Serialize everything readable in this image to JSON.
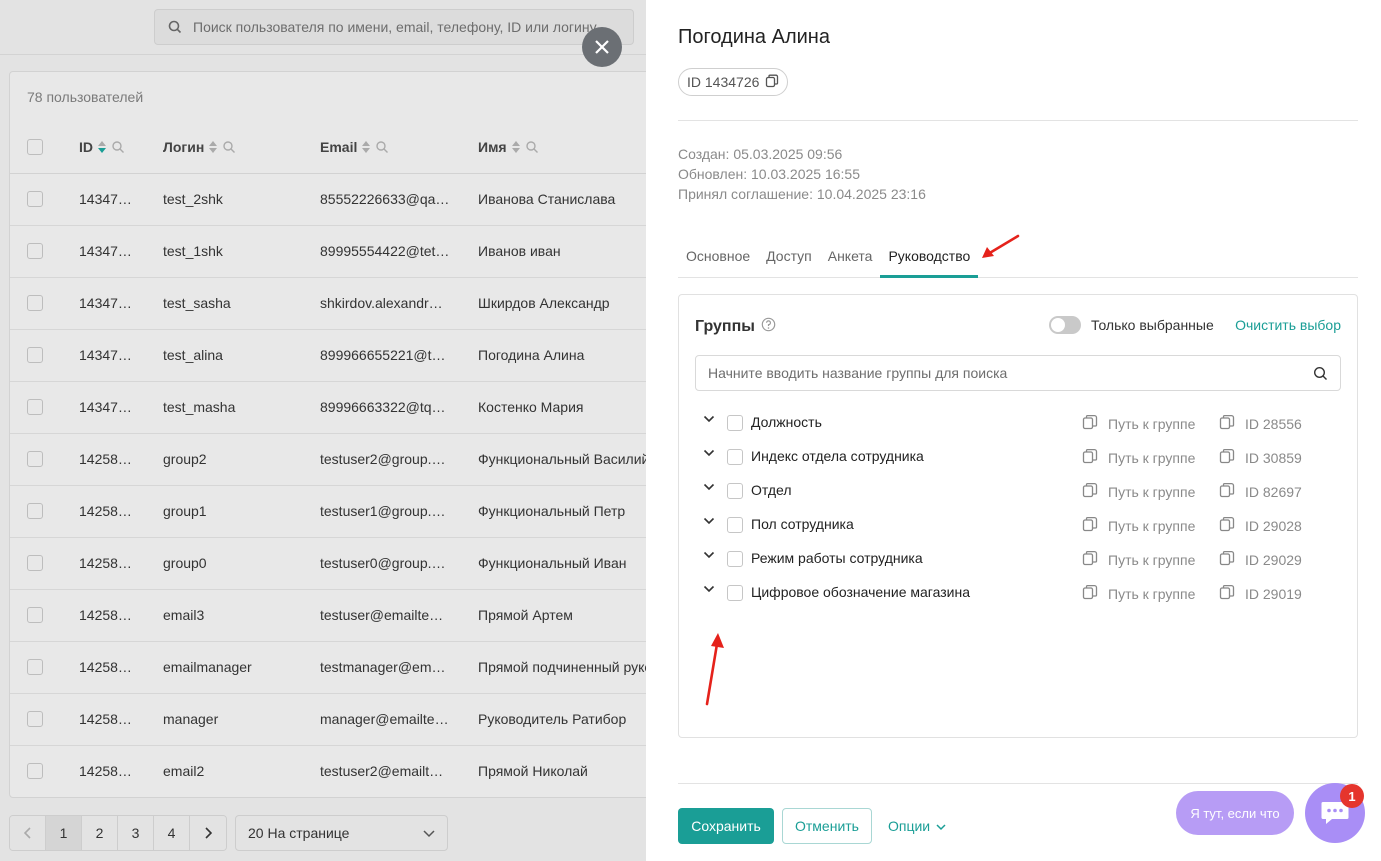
{
  "background": {
    "search_placeholder": "Поиск пользователя по имени, email, телефону, ID или логину",
    "user_count": "78 пользователей",
    "columns": {
      "id": "ID",
      "login": "Логин",
      "email": "Email",
      "name": "Имя"
    },
    "rows": [
      {
        "id": "14347…",
        "login": "test_2shk",
        "email": "85552226633@qa…",
        "name": "Иванова Станислава"
      },
      {
        "id": "14347…",
        "login": "test_1shk",
        "email": "89995554422@tet…",
        "name": "Иванов иван"
      },
      {
        "id": "14347…",
        "login": "test_sasha",
        "email": "shkirdov.alexandr…",
        "name": "Шкирдов Александр"
      },
      {
        "id": "14347…",
        "login": "test_alina",
        "email": "899966655221@t…",
        "name": "Погодина Алина"
      },
      {
        "id": "14347…",
        "login": "test_masha",
        "email": "89996663322@tq…",
        "name": "Костенко Мария"
      },
      {
        "id": "14258…",
        "login": "group2",
        "email": "testuser2@group.…",
        "name": "Функциональный Василий"
      },
      {
        "id": "14258…",
        "login": "group1",
        "email": "testuser1@group.…",
        "name": "Функциональный Петр"
      },
      {
        "id": "14258…",
        "login": "group0",
        "email": "testuser0@group.…",
        "name": "Функциональный Иван"
      },
      {
        "id": "14258…",
        "login": "email3",
        "email": "testuser@emailte…",
        "name": "Прямой Артем"
      },
      {
        "id": "14258…",
        "login": "emailmanager",
        "email": "testmanager@em…",
        "name": "Прямой подчиненный руководителя"
      },
      {
        "id": "14258…",
        "login": "manager",
        "email": "manager@emailte…",
        "name": "Руководитель Ратибор"
      },
      {
        "id": "14258…",
        "login": "email2",
        "email": "testuser2@emailt…",
        "name": "Прямой Николай"
      }
    ],
    "pages": [
      "1",
      "2",
      "3",
      "4"
    ],
    "per_page": "20 На странице"
  },
  "drawer": {
    "title": "Погодина Алина",
    "id_chip": "ID 1434726",
    "created": "Создан: 05.03.2025 09:56",
    "updated": "Обновлен: 10.03.2025 16:55",
    "agreement": "Принял соглашение: 10.04.2025 23:16",
    "tabs": [
      "Основное",
      "Доступ",
      "Анкета",
      "Руководство"
    ],
    "active_tab": "Руководство",
    "groups": {
      "title": "Группы",
      "only_selected": "Только выбранные",
      "clear": "Очистить выбор",
      "search_placeholder": "Начните вводить название группы для поиска",
      "path_label": "Путь к группе",
      "items": [
        {
          "name": "Должность",
          "id": "ID 28556"
        },
        {
          "name": "Индекс отдела сотрудника",
          "id": "ID 30859"
        },
        {
          "name": "Отдел",
          "id": "ID 82697"
        },
        {
          "name": "Пол сотрудника",
          "id": "ID 29028"
        },
        {
          "name": "Режим работы сотрудника",
          "id": "ID 29029"
        },
        {
          "name": "Цифровое обозначение магазина",
          "id": "ID 29019"
        }
      ]
    },
    "buttons": {
      "save": "Сохранить",
      "cancel": "Отменить",
      "options": "Опции"
    }
  },
  "support": {
    "pill": "Я тут, если что",
    "badge": "1"
  },
  "colors": {
    "accent": "#1a9e96",
    "chat": "#a98ef6",
    "badge": "#e5352d",
    "annotation": "#e5221b"
  }
}
